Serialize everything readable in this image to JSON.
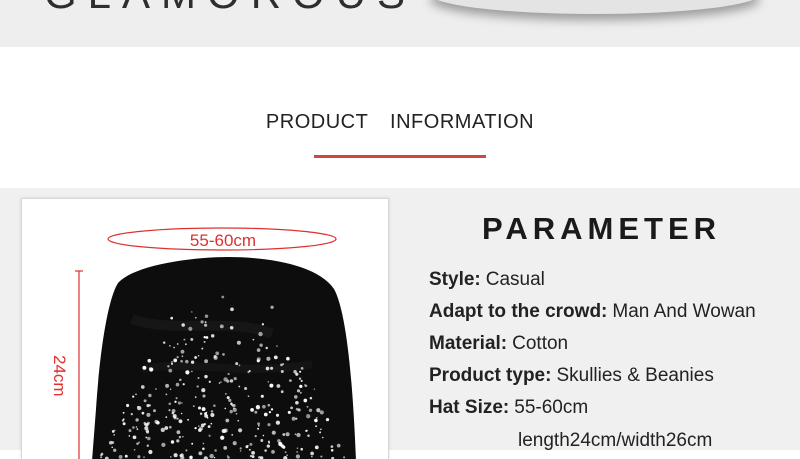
{
  "header": {
    "brand": "GLAMOROUS"
  },
  "section": {
    "title": "PRODUCT  INFORMATION"
  },
  "image": {
    "circumference_label": "55-60cm",
    "height_label": "24cm",
    "colors": {
      "hat": "#0d0d0d",
      "rhinestone": "#ffffff",
      "measure_line": "#e03030"
    }
  },
  "parameters": {
    "heading": "PARAMETER",
    "rows": [
      {
        "key": "Style:",
        "value": "Casual"
      },
      {
        "key": "Adapt to the crowd:",
        "value": "Man And Wowan"
      },
      {
        "key": "Material:",
        "value": "Cotton"
      },
      {
        "key": "Product type:",
        "value": "Skullies & Beanies"
      },
      {
        "key": "Hat Size:",
        "value": "55-60cm"
      }
    ],
    "hat_size_extra": "length24cm/width26cm"
  },
  "colors": {
    "accent": "#cc4a3d",
    "panel_bg": "#f0f0f0",
    "banner_bg": "#eeeeee"
  }
}
